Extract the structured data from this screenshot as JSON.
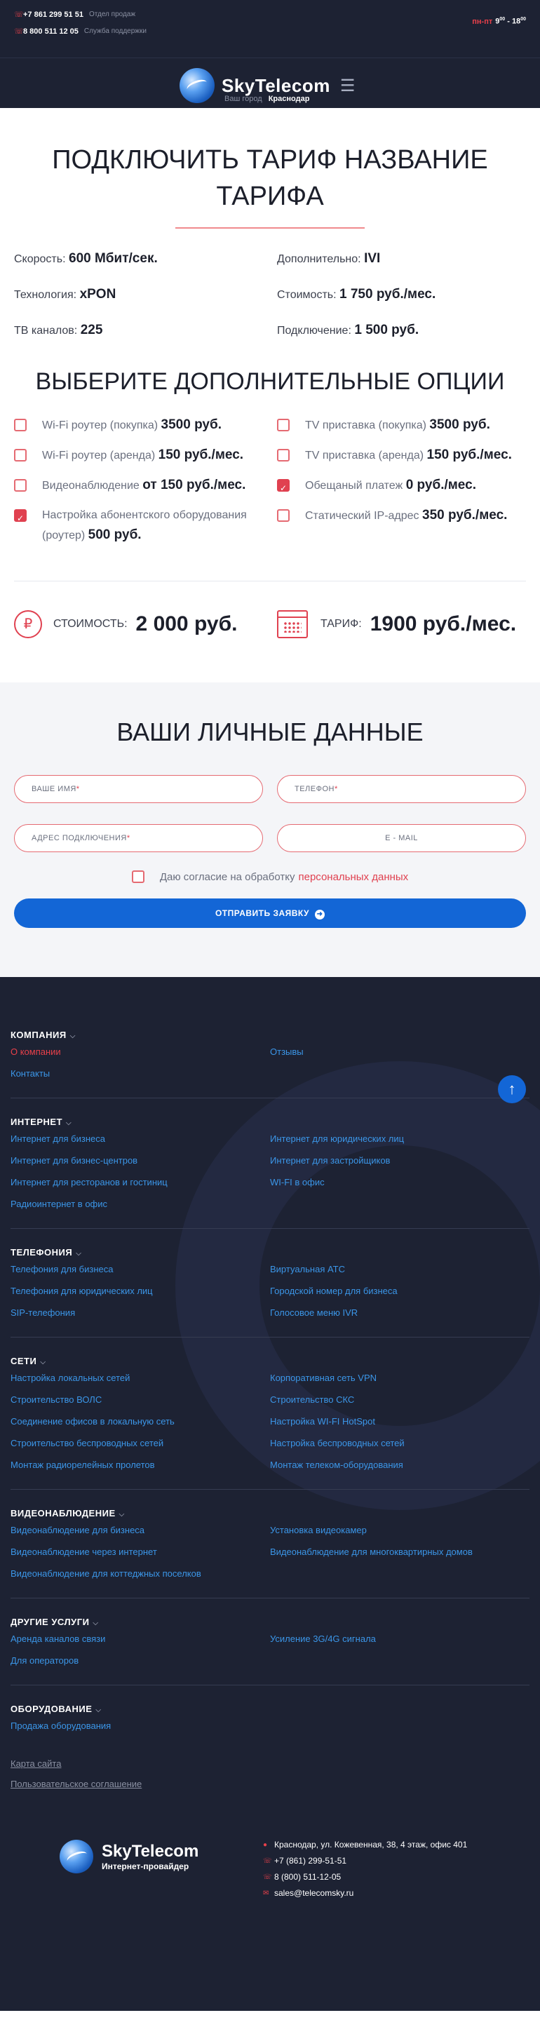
{
  "topbar": {
    "contacts": [
      {
        "icon": "phone-icon",
        "number": "+7 861 299 51 51",
        "label": "Отдел продаж"
      },
      {
        "icon": "phone-icon",
        "number": "8 800 511 12 05",
        "label": "Служба поддержки"
      }
    ],
    "hours": {
      "days": "пн-пт",
      "from": "9",
      "from_min": "00",
      "sep": " - ",
      "to": "18",
      "to_min": "00"
    }
  },
  "header": {
    "logo_text": "SkyTelecom",
    "menu_icon": "burger-icon",
    "city_label": "Ваш город",
    "city_value": "Краснодар"
  },
  "tariff": {
    "title": "ПОДКЛЮЧИТЬ ТАРИФ НАЗВАНИЕ ТАРИФА",
    "params": [
      {
        "label": "Скорость:",
        "value": "600 Мбит/сек."
      },
      {
        "label": "Дополнительно:",
        "value": "IVI"
      },
      {
        "label": "Технология:",
        "value": "xPON"
      },
      {
        "label": "Стоимость:",
        "value": "1 750 руб./мес."
      },
      {
        "label": "ТВ каналов:",
        "value": "225"
      },
      {
        "label": "Подключение:",
        "value": "1 500 руб."
      }
    ]
  },
  "options": {
    "title": "ВЫБЕРИТЕ ДОПОЛНИТЕЛЬНЫЕ ОПЦИИ",
    "items": [
      {
        "label": "Wi-Fi роутер (покупка)",
        "price": "3500 руб.",
        "checked": false
      },
      {
        "label": "TV приставка (покупка)",
        "price": "3500 руб.",
        "checked": false
      },
      {
        "label": "Wi-Fi роутер (аренда)",
        "price": "150 руб./мес.",
        "checked": false
      },
      {
        "label": "TV приставка (аренда)",
        "price": "150 руб./мес.",
        "checked": false
      },
      {
        "label": "Видеонаблюдение",
        "price": "от 150 руб./мес.",
        "checked": false
      },
      {
        "label": "Обещаный платеж",
        "price": "0 руб./мес.",
        "checked": true
      },
      {
        "label": "Настройка абонентского оборудования (роутер)",
        "price": "500 руб.",
        "checked": true
      },
      {
        "label": "Статический IP-адрес",
        "price": "350 руб./мес.",
        "checked": false
      }
    ]
  },
  "totals": {
    "cost_icon": "ruble-icon",
    "cost_label": "СТОИМОСТЬ:",
    "cost_value": "2 000 руб.",
    "tariff_icon": "calendar-icon",
    "tariff_label": "ТАРИФ:",
    "tariff_value": "1900 руб./мес."
  },
  "personal": {
    "title": "ВАШИ ЛИЧНЫЕ ДАННЫЕ",
    "fields": {
      "name": "ВАШЕ ИМЯ",
      "phone": "ТЕЛЕФОН",
      "address": "АДРЕС ПОДКЛЮЧЕНИЯ",
      "email": "E - MAIL",
      "required_mark": "*"
    },
    "consent_text": "Даю согласие на обработку",
    "consent_link": "персональных данных",
    "submit_label": "ОТПРАВИТЬ ЗАЯВКУ",
    "submit_icon": "arrow-right-icon"
  },
  "footer": {
    "sections": [
      {
        "title": "КОМПАНИЯ",
        "links": [
          "О компании",
          "Отзывы",
          "Контакты"
        ],
        "active": "О компании"
      },
      {
        "title": "ИНТЕРНЕТ",
        "links": [
          "Интернет для бизнеса",
          "Интернет для юридических лиц",
          "Интернет для бизнес-центров",
          "Интернет для застройщиков",
          "Интернет для ресторанов и гостиниц",
          "WI-FI в офис",
          "Радиоинтернет в офис"
        ]
      },
      {
        "title": "ТЕЛЕФОНИЯ",
        "links": [
          "Телефония для бизнеса",
          "Виртуальная АТС",
          "Телефония для юридических лиц",
          "Городской номер для бизнеса",
          "SIP-телефония",
          "Голосовое меню IVR"
        ]
      },
      {
        "title": "СЕТИ",
        "links": [
          "Настройка локальных сетей",
          "Корпоративная сеть VPN",
          "Строительство ВОЛС",
          "Строительство СКС",
          "Соединение офисов в локальную сеть",
          "Настройка WI-FI HotSpot",
          "Строительство беспроводных сетей",
          "Настройка беспроводных сетей",
          "Монтаж радиорелейных пролетов",
          "Монтаж телеком-оборудования"
        ]
      },
      {
        "title": "ВИДЕОНАБЛЮДЕНИЕ",
        "links": [
          "Видеонаблюдение для бизнеса",
          "Установка видеокамер",
          "Видеонаблюдение через интернет",
          "Видеонаблюдение для многоквартирных домов",
          "Видеонаблюдение для коттеджных поселков"
        ]
      },
      {
        "title": "ДРУГИЕ УСЛУГИ",
        "links": [
          "Аренда каналов связи",
          "Усиление 3G/4G сигнала",
          "Для операторов"
        ]
      },
      {
        "title": "ОБОРУДОВАНИЕ",
        "links": [
          "Продажа оборудования"
        ]
      }
    ],
    "extra_links": [
      "Карта сайта",
      "Пользовательское соглашение"
    ],
    "logo_text": "SkyTelecom",
    "logo_sub": "Интернет-провайдер",
    "contacts": [
      {
        "icon": "location-icon",
        "text": "Краснодар, ул. Кожевенная, 38, 4 этаж, офис 401"
      },
      {
        "icon": "phone-icon",
        "text": "+7 (861) 299-51-51"
      },
      {
        "icon": "phone-icon",
        "text": "8 (800) 511-12-05"
      },
      {
        "icon": "mail-icon",
        "text": "sales@telecomsky.ru"
      }
    ],
    "up_icon": "arrow-up-icon"
  }
}
